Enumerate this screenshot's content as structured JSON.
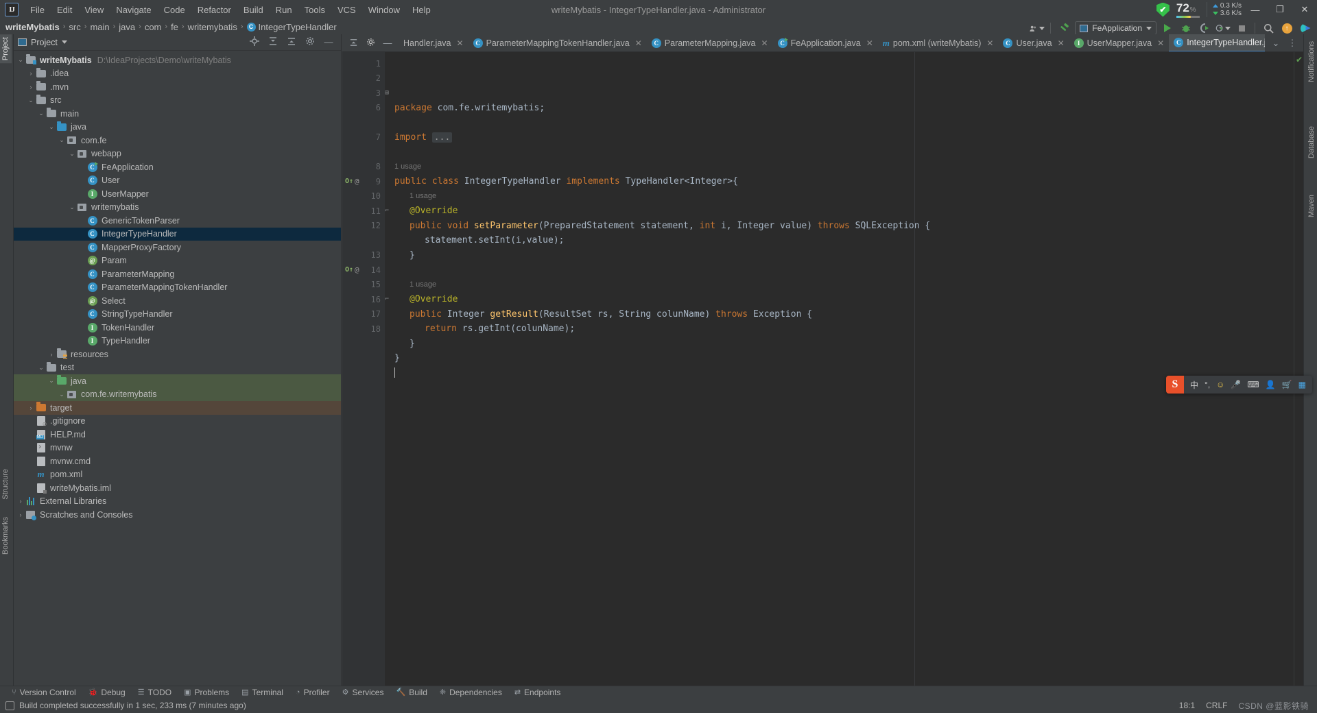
{
  "window": {
    "title": "writeMybatis - IntegerTypeHandler.java - Administrator",
    "minimize": "—",
    "maximize": "❐",
    "close": "✕"
  },
  "menubar": {
    "items": [
      "File",
      "Edit",
      "View",
      "Navigate",
      "Code",
      "Refactor",
      "Build",
      "Run",
      "Tools",
      "VCS",
      "Window",
      "Help"
    ]
  },
  "title_widgets": {
    "cpu_percent": "72",
    "cpu_unit": "%",
    "net_up": "0.3 K/s",
    "net_down": "3.6 K/s",
    "shield_glyph": "✔"
  },
  "breadcrumb": {
    "items": [
      "writeMybatis",
      "src",
      "main",
      "java",
      "com",
      "fe",
      "writemybatis"
    ],
    "separator": "›",
    "final_item": "IntegerTypeHandler",
    "final_icon": "class-icon",
    "final_icon_letter": "C"
  },
  "toolbar": {
    "run_config": "FeApplication",
    "icons": [
      "user-avatar-icon",
      "hammer-build-icon",
      "run-icon",
      "debug-icon",
      "run-with-coverage-icon",
      "profile-icon",
      "stop-icon",
      "search-everywhere-icon",
      "update-project-icon",
      "ide-assistant-icon"
    ]
  },
  "left_stripe": {
    "top_label": "Project",
    "bottom_labels": [
      "Structure",
      "Bookmarks"
    ]
  },
  "right_stripe": {
    "labels": [
      "Notifications",
      "Database",
      "Maven"
    ]
  },
  "project_panel": {
    "title": "Project",
    "header_icons": [
      "select-opened-file-icon",
      "expand-all-icon",
      "collapse-all-icon",
      "settings-icon",
      "hide-icon"
    ],
    "tree": [
      {
        "depth": 0,
        "arrow": "v",
        "icon": "module-folder",
        "label": "writeMybatis",
        "bold": true,
        "path": "D:\\IdeaProjects\\Demo\\writeMybatis",
        "state": "none"
      },
      {
        "depth": 1,
        "arrow": ">",
        "icon": "folder",
        "label": ".idea",
        "state": "none"
      },
      {
        "depth": 1,
        "arrow": ">",
        "icon": "folder",
        "label": ".mvn",
        "state": "none"
      },
      {
        "depth": 1,
        "arrow": "v",
        "icon": "folder",
        "label": "src",
        "state": "none"
      },
      {
        "depth": 2,
        "arrow": "v",
        "icon": "folder",
        "label": "main",
        "state": "none"
      },
      {
        "depth": 3,
        "arrow": "v",
        "icon": "folder-blue",
        "label": "java",
        "state": "none"
      },
      {
        "depth": 4,
        "arrow": "v",
        "icon": "package",
        "label": "com.fe",
        "state": "none"
      },
      {
        "depth": 5,
        "arrow": "v",
        "icon": "package",
        "label": "webapp",
        "state": "none"
      },
      {
        "depth": 6,
        "arrow": "",
        "icon": "class-runnable",
        "label": "FeApplication",
        "state": "none"
      },
      {
        "depth": 6,
        "arrow": "",
        "icon": "class",
        "label": "User",
        "state": "none"
      },
      {
        "depth": 6,
        "arrow": "",
        "icon": "interface",
        "label": "UserMapper",
        "state": "none"
      },
      {
        "depth": 5,
        "arrow": "v",
        "icon": "package",
        "label": "writemybatis",
        "state": "none"
      },
      {
        "depth": 6,
        "arrow": "",
        "icon": "class",
        "label": "GenericTokenParser",
        "state": "none"
      },
      {
        "depth": 6,
        "arrow": "",
        "icon": "class",
        "label": "IntegerTypeHandler",
        "state": "selected"
      },
      {
        "depth": 6,
        "arrow": "",
        "icon": "class",
        "label": "MapperProxyFactory",
        "state": "none"
      },
      {
        "depth": 6,
        "arrow": "",
        "icon": "annotation",
        "label": "Param",
        "state": "none"
      },
      {
        "depth": 6,
        "arrow": "",
        "icon": "class",
        "label": "ParameterMapping",
        "state": "none"
      },
      {
        "depth": 6,
        "arrow": "",
        "icon": "class",
        "label": "ParameterMappingTokenHandler",
        "state": "none"
      },
      {
        "depth": 6,
        "arrow": "",
        "icon": "annotation",
        "label": "Select",
        "state": "none"
      },
      {
        "depth": 6,
        "arrow": "",
        "icon": "class",
        "label": "StringTypeHandler",
        "state": "none"
      },
      {
        "depth": 6,
        "arrow": "",
        "icon": "interface",
        "label": "TokenHandler",
        "state": "none"
      },
      {
        "depth": 6,
        "arrow": "",
        "icon": "interface",
        "label": "TypeHandler",
        "state": "none"
      },
      {
        "depth": 3,
        "arrow": ">",
        "icon": "folder-resources",
        "label": "resources",
        "state": "none"
      },
      {
        "depth": 2,
        "arrow": "v",
        "icon": "folder",
        "label": "test",
        "state": "none"
      },
      {
        "depth": 3,
        "arrow": "v",
        "icon": "folder-green",
        "label": "java",
        "state": "green"
      },
      {
        "depth": 4,
        "arrow": "v",
        "icon": "package",
        "label": "com.fe.writemybatis",
        "state": "green"
      },
      {
        "depth": 1,
        "arrow": ">",
        "icon": "folder-orange",
        "label": "target",
        "state": "brown"
      },
      {
        "depth": 1,
        "arrow": "",
        "icon": "file-git",
        "label": ".gitignore",
        "state": "none"
      },
      {
        "depth": 1,
        "arrow": "",
        "icon": "file-md",
        "label": "HELP.md",
        "state": "none"
      },
      {
        "depth": 1,
        "arrow": "",
        "icon": "file-sh",
        "label": "mvnw",
        "state": "none"
      },
      {
        "depth": 1,
        "arrow": "",
        "icon": "file",
        "label": "mvnw.cmd",
        "state": "none"
      },
      {
        "depth": 1,
        "arrow": "",
        "icon": "file-maven",
        "label": "pom.xml",
        "state": "none"
      },
      {
        "depth": 1,
        "arrow": "",
        "icon": "file-iml",
        "label": "writeMybatis.iml",
        "state": "none"
      },
      {
        "depth": 0,
        "arrow": ">",
        "icon": "external-libraries",
        "label": "External Libraries",
        "state": "none"
      },
      {
        "depth": 0,
        "arrow": ">",
        "icon": "scratches",
        "label": "Scratches and Consoles",
        "state": "none"
      }
    ]
  },
  "editor": {
    "tabs": [
      {
        "label": "Handler.java",
        "icon": "",
        "active": false
      },
      {
        "label": "ParameterMappingTokenHandler.java",
        "icon": "class",
        "active": false
      },
      {
        "label": "ParameterMapping.java",
        "icon": "class",
        "active": false
      },
      {
        "label": "FeApplication.java",
        "icon": "class-runnable",
        "active": false
      },
      {
        "label": "pom.xml (writeMybatis)",
        "icon": "maven",
        "active": false
      },
      {
        "label": "User.java",
        "icon": "class",
        "active": false
      },
      {
        "label": "UserMapper.java",
        "icon": "interface",
        "active": false
      },
      {
        "label": "IntegerTypeHandler.java",
        "icon": "class",
        "active": true
      }
    ],
    "tab_close_glyph": "✕",
    "tabs_right_icons": [
      "chevron-down-icon",
      "more-options-icon"
    ],
    "lines": [
      {
        "num": "1",
        "indent": 0,
        "tokens": [
          [
            "kw",
            "package"
          ],
          [
            "typ",
            " com.fe.writemybatis;"
          ]
        ]
      },
      {
        "num": "2",
        "indent": 0,
        "tokens": []
      },
      {
        "num": "3",
        "indent": 0,
        "fold": "+",
        "tokens": [
          [
            "kw",
            "import"
          ],
          [
            "typ",
            " "
          ],
          [
            "fold",
            "..."
          ]
        ]
      },
      {
        "num": "6",
        "indent": 0,
        "tokens": []
      },
      {
        "num": "",
        "indent": 0,
        "usage": "1 usage"
      },
      {
        "num": "7",
        "indent": 0,
        "tokens": [
          [
            "kw",
            "public class"
          ],
          [
            "typ",
            " IntegerTypeHandler "
          ],
          [
            "kw",
            "implements"
          ],
          [
            "typ",
            " TypeHandler<Integer>{"
          ]
        ]
      },
      {
        "num": "",
        "indent": 1,
        "usage": "1 usage"
      },
      {
        "num": "8",
        "indent": 1,
        "tokens": [
          [
            "ann",
            "@Override"
          ]
        ]
      },
      {
        "num": "9",
        "indent": 1,
        "gutter_mark": "override",
        "tokens": [
          [
            "kw",
            "public void "
          ],
          [
            "meth",
            "setParameter"
          ],
          [
            "typ",
            "(PreparedStatement statement, "
          ],
          [
            "kw",
            "int"
          ],
          [
            "typ",
            " i, Integer value) "
          ],
          [
            "kw",
            "throws"
          ],
          [
            "typ",
            " SQLException {"
          ]
        ]
      },
      {
        "num": "10",
        "indent": 2,
        "tokens": [
          [
            "typ",
            "statement.setInt(i,value);"
          ]
        ]
      },
      {
        "num": "11",
        "indent": 1,
        "fold": "-",
        "tokens": [
          [
            "typ",
            "}"
          ]
        ]
      },
      {
        "num": "12",
        "indent": 0,
        "tokens": []
      },
      {
        "num": "",
        "indent": 1,
        "usage": "1 usage"
      },
      {
        "num": "13",
        "indent": 1,
        "tokens": [
          [
            "ann",
            "@Override"
          ]
        ]
      },
      {
        "num": "14",
        "indent": 1,
        "gutter_mark": "override",
        "tokens": [
          [
            "kw",
            "public "
          ],
          [
            "typ",
            "Integer "
          ],
          [
            "meth",
            "getResult"
          ],
          [
            "typ",
            "(ResultSet rs, String colunName) "
          ],
          [
            "kw",
            "throws"
          ],
          [
            "typ",
            " Exception {"
          ]
        ]
      },
      {
        "num": "15",
        "indent": 2,
        "tokens": [
          [
            "kw",
            "return"
          ],
          [
            "typ",
            " rs.getInt(colunName);"
          ]
        ]
      },
      {
        "num": "16",
        "indent": 1,
        "fold": "-",
        "tokens": [
          [
            "typ",
            "}"
          ]
        ]
      },
      {
        "num": "17",
        "indent": 0,
        "tokens": [
          [
            "typ",
            "}"
          ]
        ]
      },
      {
        "num": "18",
        "indent": 0,
        "tokens": [],
        "caret": true
      }
    ],
    "inspection_status": "✔"
  },
  "ime": {
    "logo": "S",
    "items": [
      "中",
      "°,",
      "☺",
      "🎤",
      "⌨",
      "👤",
      "🛒",
      "▦"
    ]
  },
  "bottom_tools": [
    {
      "label": "Version Control",
      "icon": "branch-icon"
    },
    {
      "label": "Debug",
      "icon": "debug-icon"
    },
    {
      "label": "TODO",
      "icon": "todo-icon"
    },
    {
      "label": "Problems",
      "icon": "problems-icon"
    },
    {
      "label": "Terminal",
      "icon": "terminal-icon"
    },
    {
      "label": "Profiler",
      "icon": "profiler-icon"
    },
    {
      "label": "Services",
      "icon": "services-icon"
    },
    {
      "label": "Build",
      "icon": "build-icon"
    },
    {
      "label": "Dependencies",
      "icon": "dependencies-icon"
    },
    {
      "label": "Endpoints",
      "icon": "endpoints-icon"
    }
  ],
  "statusbar": {
    "message": "Build completed successfully in 1 sec, 233 ms (7 minutes ago)",
    "caret_position": "18:1",
    "line_separator": "CRLF",
    "watermark": "CSDN @蓝影铁骑"
  }
}
